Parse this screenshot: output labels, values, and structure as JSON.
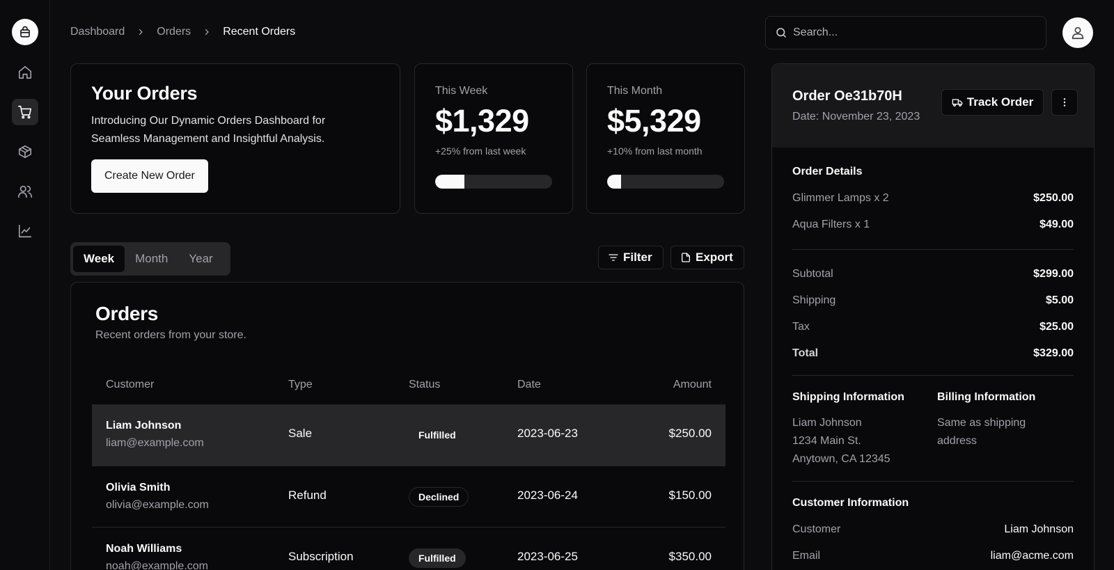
{
  "breadcrumb": [
    "Dashboard",
    "Orders",
    "Recent Orders"
  ],
  "search": {
    "placeholder": "Search..."
  },
  "intro": {
    "title": "Your Orders",
    "description": "Introducing Our Dynamic Orders Dashboard for Seamless Management and Insightful Analysis.",
    "button": "Create New Order"
  },
  "stats": {
    "week": {
      "label": "This Week",
      "value": "$1,329",
      "change": "+25% from last week",
      "progress_pct": 25
    },
    "month": {
      "label": "This Month",
      "value": "$5,329",
      "change": "+10% from last month",
      "progress_pct": 12
    }
  },
  "tabs": [
    "Week",
    "Month",
    "Year"
  ],
  "toolbar": {
    "filter": "Filter",
    "export": "Export"
  },
  "orders": {
    "title": "Orders",
    "subtitle": "Recent orders from your store.",
    "columns": [
      "Customer",
      "Type",
      "Status",
      "Date",
      "Amount"
    ],
    "rows": [
      {
        "name": "Liam Johnson",
        "email": "liam@example.com",
        "type": "Sale",
        "status": "Fulfilled",
        "date": "2023-06-23",
        "amount": "$250.00"
      },
      {
        "name": "Olivia Smith",
        "email": "olivia@example.com",
        "type": "Refund",
        "status": "Declined",
        "date": "2023-06-24",
        "amount": "$150.00"
      },
      {
        "name": "Noah Williams",
        "email": "noah@example.com",
        "type": "Subscription",
        "status": "Fulfilled",
        "date": "2023-06-25",
        "amount": "$350.00"
      }
    ]
  },
  "detail": {
    "title": "Order Oe31b70H",
    "date": "Date: November 23, 2023",
    "track": "Track Order",
    "order_details_title": "Order Details",
    "items": [
      {
        "label": "Glimmer Lamps x 2",
        "value": "$250.00"
      },
      {
        "label": "Aqua Filters x 1",
        "value": "$49.00"
      }
    ],
    "subtotal": {
      "label": "Subtotal",
      "value": "$299.00"
    },
    "shipping": {
      "label": "Shipping",
      "value": "$5.00"
    },
    "tax": {
      "label": "Tax",
      "value": "$25.00"
    },
    "total": {
      "label": "Total",
      "value": "$329.00"
    },
    "shipping_info_title": "Shipping Information",
    "shipping_address": [
      "Liam Johnson",
      "1234 Main St.",
      "Anytown, CA 12345"
    ],
    "billing_info_title": "Billing Information",
    "billing_address": [
      "Same as shipping",
      "address"
    ],
    "customer_info_title": "Customer Information",
    "customer": {
      "label": "Customer",
      "value": "Liam Johnson"
    },
    "email": {
      "label": "Email",
      "value": "liam@acme.com"
    }
  }
}
